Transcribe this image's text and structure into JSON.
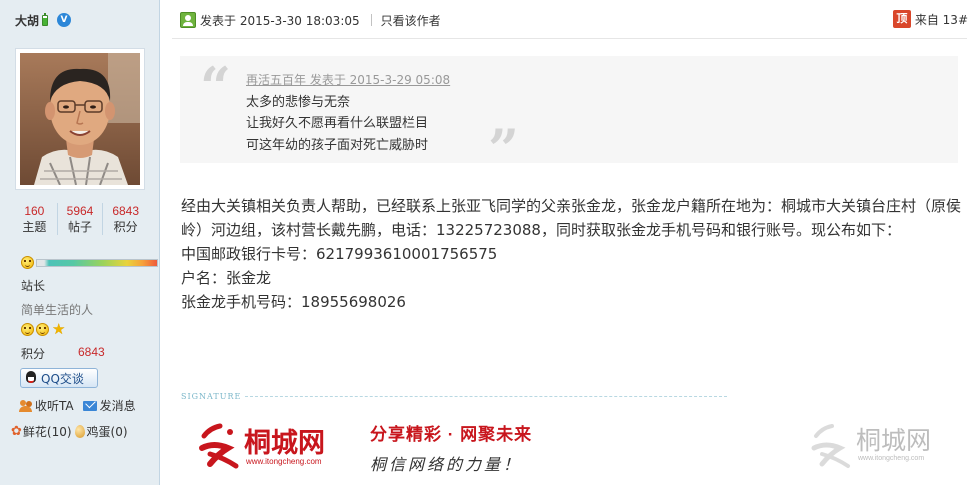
{
  "user": {
    "name": "大胡",
    "stats": [
      {
        "value": "160",
        "label": "主题"
      },
      {
        "value": "5964",
        "label": "帖子"
      },
      {
        "value": "6843",
        "label": "积分"
      }
    ],
    "level_title": "站长",
    "signature_text": "简单生活的人",
    "points_label": "积分",
    "points_value": "6843",
    "qq_button": "QQ交谈",
    "follow_label": "收听TA",
    "message_label": "发消息",
    "flower_label": "鲜花(10)",
    "egg_label": "鸡蛋(0)"
  },
  "post": {
    "posted_at": "发表于 2015-3-30 18:03:05",
    "author_only": "只看该作者",
    "floor": "来自 13#",
    "top_badge": "顶",
    "quote": {
      "source": "再活五百年 发表于 2015-3-29 05:08",
      "lines": [
        "太多的悲惨与无奈",
        "让我好久不愿再看什么联盟栏目",
        "可这年幼的孩子面对死亡威胁时"
      ]
    },
    "body": [
      "经由大关镇相关负责人帮助，已经联系上张亚飞同学的父亲张金龙，张金龙户籍所在地为：桐城市大关镇台庄村（原侯岭）河边组，该村营长戴先鹏，电话：13225723088，同时获取张金龙手机号码和银行账号。现公布如下：",
      "中国邮政银行卡号：6217993610001756575",
      "户名：张金龙",
      "张金龙手机号码：18955698026"
    ]
  },
  "signature": {
    "label": "SIGNATURE",
    "logo_name": "桐城网",
    "logo_url": "www.itongcheng.com",
    "slogan": "分享精彩 · 网聚未来",
    "slogan2": "桐信网络的力量！",
    "watermark_name": "桐城网",
    "watermark_url": "www.itongcheng.com"
  },
  "colors": {
    "sidebar_bg": "#e5edf2",
    "stat_value": "#c8292a",
    "quote_bg": "#f6f6f6",
    "logo_red": "#c8161d"
  }
}
